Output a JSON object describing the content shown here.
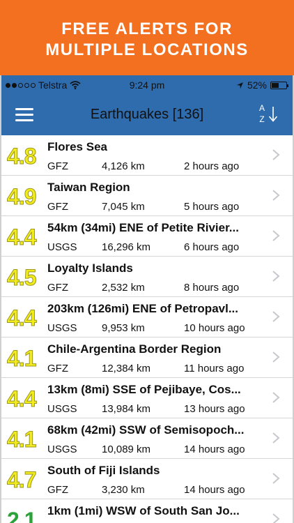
{
  "promo": {
    "line1": "FREE ALERTS FOR",
    "line2": "MULTIPLE LOCATIONS"
  },
  "status_bar": {
    "carrier": "Telstra",
    "time": "9:24 pm",
    "battery": "52%",
    "battery_level": 0.52
  },
  "nav": {
    "title": "Earthquakes [136]",
    "sort_top": "A",
    "sort_bottom": "Z",
    "sort_icon": "sort-az-icon",
    "menu_icon": "hamburger-menu-icon"
  },
  "earthquakes": [
    {
      "mag": "4.8",
      "place": "Flores Sea",
      "source": "GFZ",
      "distance": "4,126 km",
      "ago": "2 hours ago"
    },
    {
      "mag": "4.9",
      "place": "Taiwan Region",
      "source": "GFZ",
      "distance": "7,045 km",
      "ago": "5 hours ago"
    },
    {
      "mag": "4.4",
      "place": "54km (34mi) ENE of Petite Rivier...",
      "source": "USGS",
      "distance": "16,296 km",
      "ago": "6 hours ago"
    },
    {
      "mag": "4.5",
      "place": "Loyalty Islands",
      "source": "GFZ",
      "distance": "2,532 km",
      "ago": "8 hours ago"
    },
    {
      "mag": "4.4",
      "place": "203km (126mi) ENE of Petropavl...",
      "source": "USGS",
      "distance": "9,953 km",
      "ago": "10 hours ago"
    },
    {
      "mag": "4.1",
      "place": "Chile-Argentina Border Region",
      "source": "GFZ",
      "distance": "12,384 km",
      "ago": "11 hours ago"
    },
    {
      "mag": "4.4",
      "place": "13km (8mi) SSE of Pejibaye, Cos...",
      "source": "USGS",
      "distance": "13,984 km",
      "ago": "13 hours ago"
    },
    {
      "mag": "4.1",
      "place": "68km (42mi) SSW of Semisopoch...",
      "source": "USGS",
      "distance": "10,089 km",
      "ago": "14 hours ago"
    },
    {
      "mag": "4.7",
      "place": "South of Fiji Islands",
      "source": "GFZ",
      "distance": "3,230 km",
      "ago": "14 hours ago"
    },
    {
      "mag": "2.1",
      "place": "1km (1mi) WSW of South San Jo...",
      "source": "",
      "distance": "",
      "ago": ""
    }
  ],
  "colors": {
    "promo": "#f37021",
    "navbar": "#2f6cae",
    "mag_yellow": "#f2ec1c",
    "mag_green": "#2ea23a"
  }
}
